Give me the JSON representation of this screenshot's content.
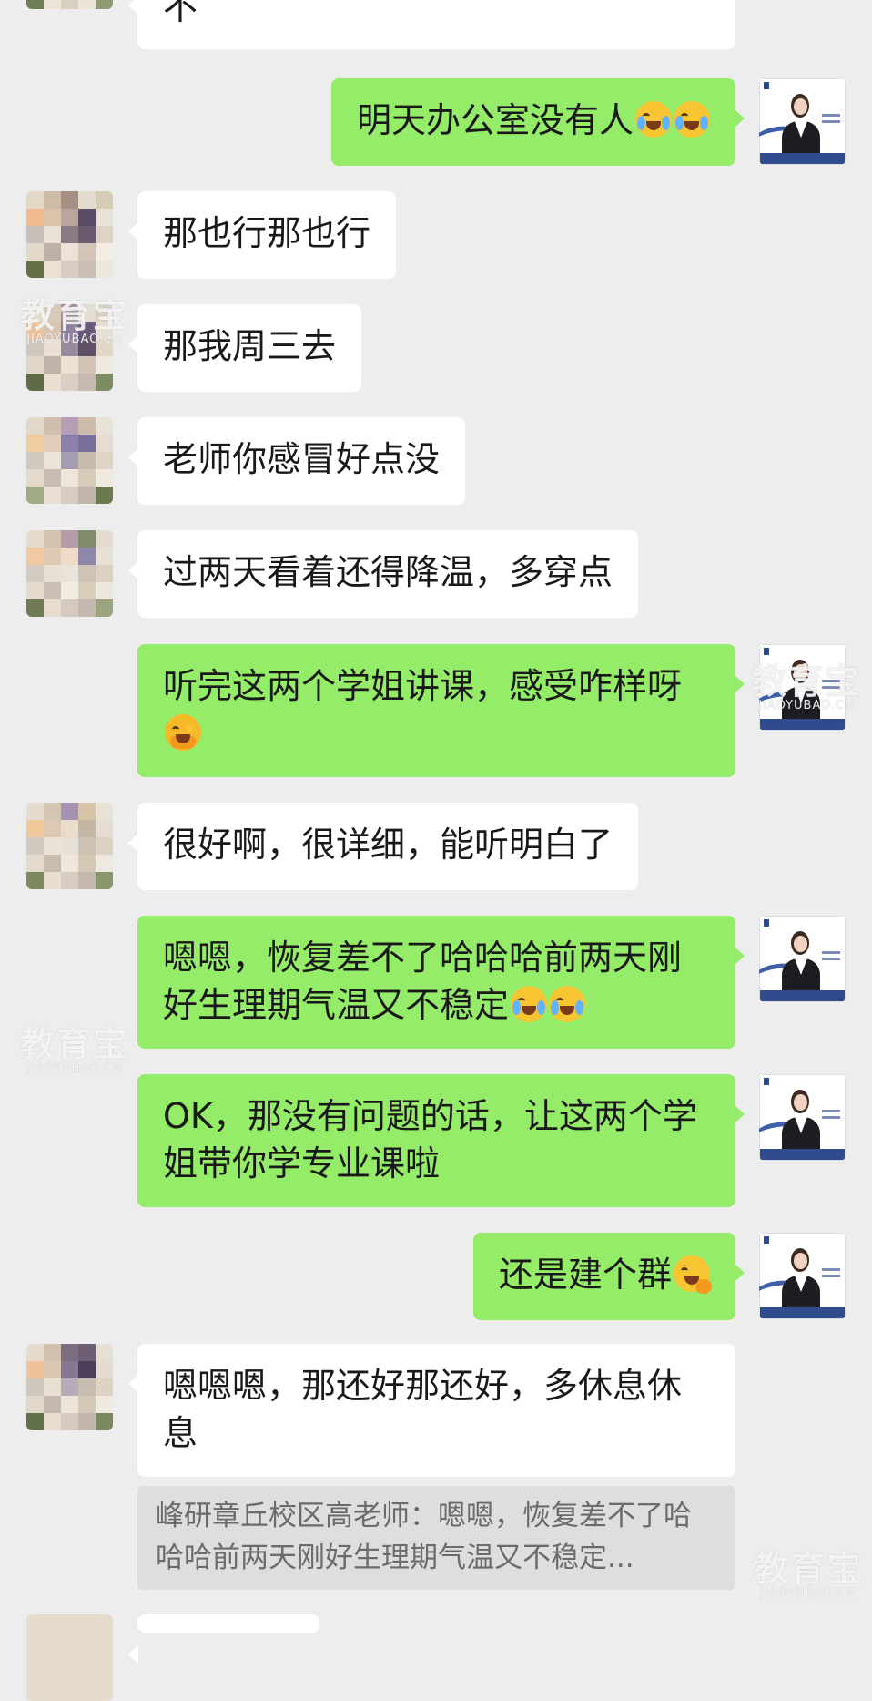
{
  "colors": {
    "background": "#ededed",
    "bubble_left": "#ffffff",
    "bubble_right": "#95ec69",
    "quote_bg": "#dedede",
    "quote_text": "#6b6b6b"
  },
  "messages": [
    {
      "side": "left",
      "text": "不"
    },
    {
      "side": "right",
      "text": "明天办公室没有人",
      "emoji": [
        "cry-laugh-icon",
        "cry-laugh-icon"
      ]
    },
    {
      "side": "left",
      "text": "那也行那也行"
    },
    {
      "side": "left",
      "text": "那我周三去"
    },
    {
      "side": "left",
      "text": "老师你感冒好点没"
    },
    {
      "side": "left",
      "text": "过两天看着还得降温，多穿点"
    },
    {
      "side": "right",
      "text": "听完这两个学姐讲课，感受咋样呀",
      "emoji": [
        "shy-hands-icon"
      ]
    },
    {
      "side": "left",
      "text": "很好啊，很详细，能听明白了"
    },
    {
      "side": "right",
      "text": "嗯嗯，恢复差不了哈哈哈前两天刚好生理期气温又不稳定",
      "emoji": [
        "cry-laugh-icon",
        "cry-laugh-icon"
      ]
    },
    {
      "side": "right",
      "text": "OK，那没有问题的话，让这两个学姐带你学专业课啦"
    },
    {
      "side": "right",
      "text": "还是建个群",
      "emoji": [
        "thinking-icon"
      ]
    },
    {
      "side": "left",
      "text": "嗯嗯嗯，那还好那还好，多休息休息"
    }
  ],
  "quote": {
    "text": "峰研章丘校区高老师：嗯嗯，恢复差不了哈哈哈前两天刚好生理期气温又不稳定..."
  },
  "watermark": {
    "cn": "教育宝",
    "en": "JIAOYUBAO.CN"
  }
}
